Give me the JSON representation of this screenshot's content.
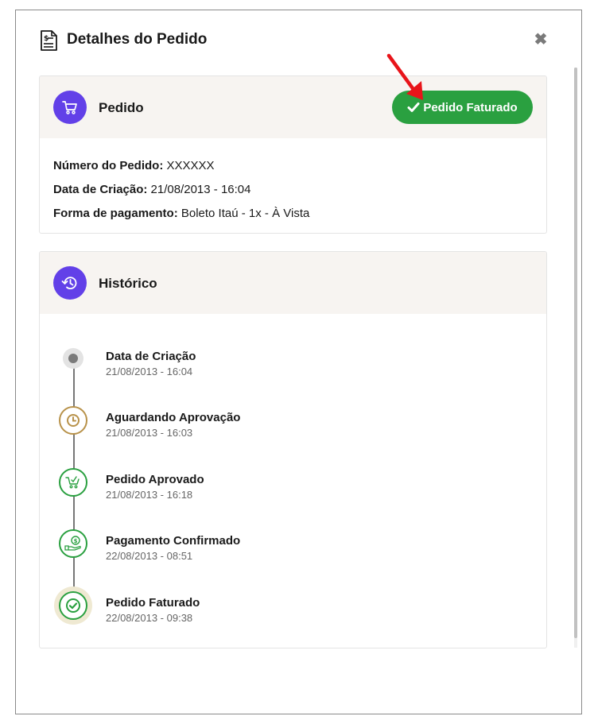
{
  "modal": {
    "title": "Detalhes do Pedido",
    "close_label": "✖"
  },
  "order": {
    "title": "Pedido",
    "status_badge": "Pedido Faturado",
    "fields": [
      {
        "label": "Número do Pedido:",
        "value": "XXXXXX"
      },
      {
        "label": "Data de Criação:",
        "value": "21/08/2013 - 16:04"
      },
      {
        "label": "Forma de pagamento:",
        "value": "Boleto Itaú - 1x - À Vista"
      }
    ]
  },
  "history": {
    "title": "Histórico",
    "events": [
      {
        "title": "Data de Criação",
        "date": "21/08/2013 - 16:04",
        "icon": "dot-icon",
        "color": "#8a8a8a"
      },
      {
        "title": "Aguardando Aprovação",
        "date": "21/08/2013 - 16:03",
        "icon": "clock-icon",
        "color": "#b8924a"
      },
      {
        "title": "Pedido Aprovado",
        "date": "21/08/2013 - 16:18",
        "icon": "cart-check-icon",
        "color": "#2aa040"
      },
      {
        "title": "Pagamento Confirmado",
        "date": "22/08/2013 - 08:51",
        "icon": "payment-icon",
        "color": "#2aa040"
      },
      {
        "title": "Pedido Faturado",
        "date": "22/08/2013 - 09:38",
        "icon": "check-circle-icon",
        "color": "#2aa040"
      }
    ]
  },
  "colors": {
    "accent": "#6240e8",
    "success": "#2aa040",
    "pending": "#b8924a",
    "card_header_bg": "#f7f4f1",
    "annotation_arrow": "#e8141a"
  }
}
